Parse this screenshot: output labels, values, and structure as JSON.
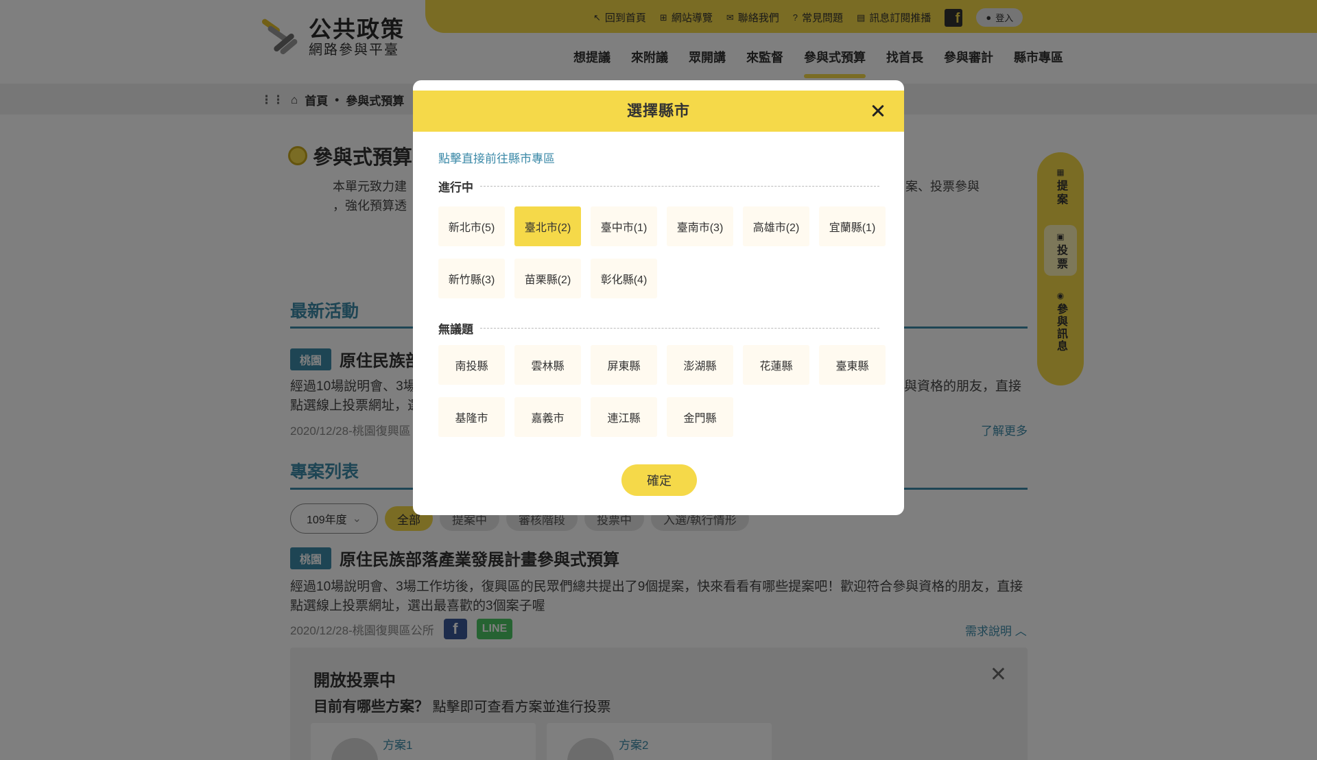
{
  "header": {
    "logo_title": "公共政策",
    "logo_subtitle": "網路參與平臺",
    "top_links": [
      {
        "icon": "home-link-icon",
        "label": "回到首頁"
      },
      {
        "icon": "sitemap-icon",
        "label": "網站導覽"
      },
      {
        "icon": "mail-icon",
        "label": "聯絡我們"
      },
      {
        "icon": "question-icon",
        "label": "常見問題"
      },
      {
        "icon": "message-icon",
        "label": "訊息訂閱推播"
      }
    ],
    "facebook_label": "f",
    "login_label": "登入",
    "nav": [
      {
        "label": "想提議",
        "active": false
      },
      {
        "label": "來附議",
        "active": false
      },
      {
        "label": "眾開講",
        "active": false
      },
      {
        "label": "來監督",
        "active": false
      },
      {
        "label": "參與式預算",
        "active": true
      },
      {
        "label": "找首長",
        "active": false
      },
      {
        "label": "參與審計",
        "active": false
      },
      {
        "label": "縣市專區",
        "active": false
      }
    ]
  },
  "breadcrumb": {
    "home": "首頁",
    "separator": "•",
    "current": "參與式預算"
  },
  "page": {
    "title": "參與式預算",
    "intro_line1": "本單元致力建",
    "intro_line2": "，強化預算透",
    "intro_right": "案、投票參與"
  },
  "latest": {
    "heading": "最新活動",
    "tag": "桃園",
    "title": "原住民族部",
    "desc_line1": "經過10場說明會、3場",
    "desc_line1_right": "與資格的朋友，直接",
    "desc_line2": "點選線上投票網址，選",
    "meta": "2020/12/28-桃園復興區",
    "more": "了解更多"
  },
  "projects": {
    "heading": "專案列表",
    "year": "109年度",
    "filters": [
      {
        "label": "全部",
        "active": true
      },
      {
        "label": "提案中",
        "active": false
      },
      {
        "label": "審核階段",
        "active": false
      },
      {
        "label": "投票中",
        "active": false
      },
      {
        "label": "入選/執行情形",
        "active": false
      }
    ],
    "tag": "桃園",
    "title": "原住民族部落產業發展計畫參與式預算",
    "desc_line1": "經過10場說明會、3場工作坊後，復興區的民眾們總共提出了9個提案，快來看看有哪些提案吧！歡迎符合參與資格的朋友，直接",
    "desc_line2": "點選線上投票網址，選出最喜歡的3個案子喔",
    "meta": "2020/12/28-桃園復興區公所",
    "share_fb": "f",
    "share_line": "LINE",
    "more": "需求說明"
  },
  "vote_panel": {
    "title": "開放投票中",
    "subtitle_q": "目前有哪些方案？",
    "subtitle_hint": "點擊即可查看方案並進行投票",
    "plans": [
      "方案1",
      "方案2"
    ]
  },
  "side_tab": {
    "groups": [
      {
        "icon": "proposal-icon",
        "text": "提案"
      },
      {
        "icon": "vote-icon",
        "text": "投票"
      },
      {
        "icon": "info-icon",
        "text": "參與訊息"
      }
    ]
  },
  "modal": {
    "title": "選擇縣市",
    "hint": "點擊直接前往縣市專區",
    "ongoing_label": "進行中",
    "ongoing": [
      {
        "label": "新北市(5)",
        "selected": false
      },
      {
        "label": "臺北市(2)",
        "selected": true
      },
      {
        "label": "臺中市(1)",
        "selected": false
      },
      {
        "label": "臺南市(3)",
        "selected": false
      },
      {
        "label": "高雄市(2)",
        "selected": false
      },
      {
        "label": "宜蘭縣(1)",
        "selected": false
      },
      {
        "label": "新竹縣(3)",
        "selected": false
      },
      {
        "label": "苗栗縣(2)",
        "selected": false
      },
      {
        "label": "彰化縣(4)",
        "selected": false
      }
    ],
    "none_label": "無議題",
    "none": [
      {
        "label": "南投縣"
      },
      {
        "label": "雲林縣"
      },
      {
        "label": "屏東縣"
      },
      {
        "label": "澎湖縣"
      },
      {
        "label": "花蓮縣"
      },
      {
        "label": "臺東縣"
      },
      {
        "label": "基隆市"
      },
      {
        "label": "嘉義市"
      },
      {
        "label": "連江縣"
      },
      {
        "label": "金門縣"
      }
    ],
    "confirm": "確定"
  },
  "colors": {
    "accent": "#f5d949",
    "link": "#3c8aa8",
    "overlay": "rgba(0,0,0,0.5)"
  }
}
